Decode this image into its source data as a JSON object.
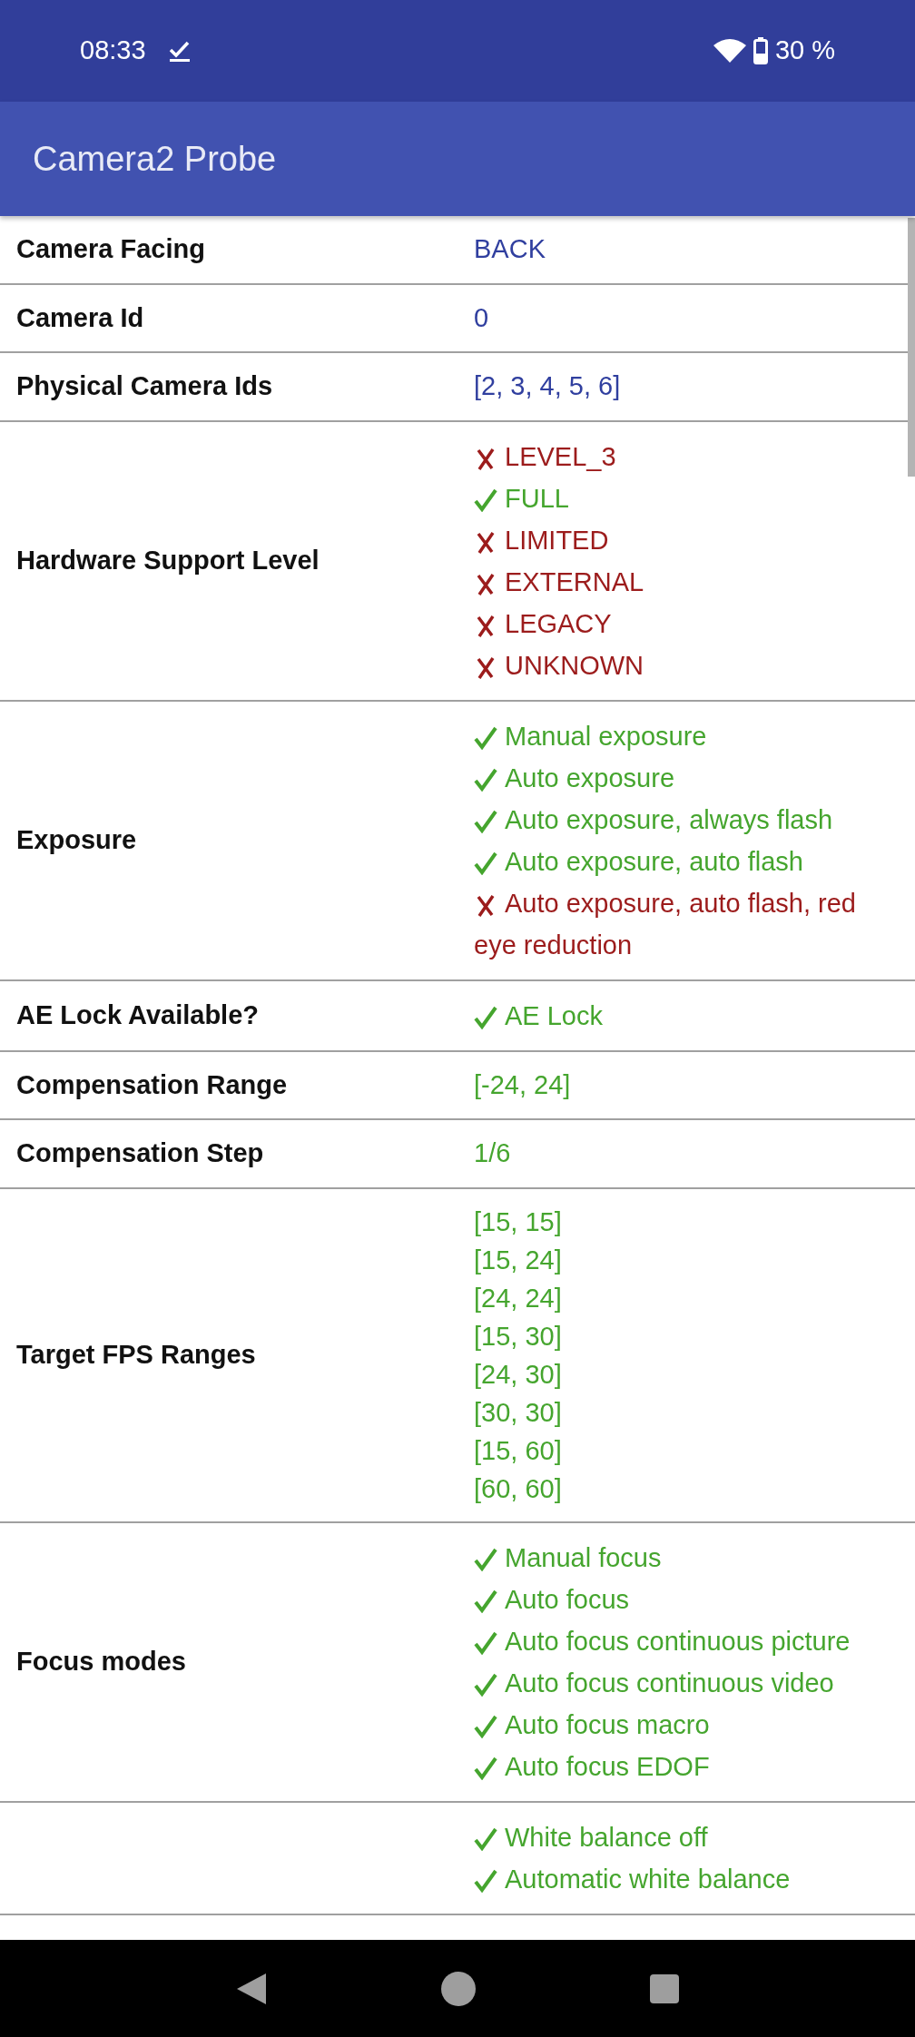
{
  "status_bar": {
    "time": "08:33",
    "battery": "30 %"
  },
  "app_bar": {
    "title": "Camera2 Probe"
  },
  "rows": [
    {
      "label": "Camera Facing",
      "kind": "info",
      "lines": [
        "BACK"
      ]
    },
    {
      "label": "Camera Id",
      "kind": "info",
      "lines": [
        "0"
      ]
    },
    {
      "label": "Physical Camera Ids",
      "kind": "info",
      "lines": [
        "[2, 3, 4, 5, 6]"
      ]
    },
    {
      "label": "Hardware Support Level",
      "kind": "checks",
      "items": [
        {
          "text": "LEVEL_3",
          "supported": false
        },
        {
          "text": "FULL",
          "supported": true
        },
        {
          "text": "LIMITED",
          "supported": false
        },
        {
          "text": "EXTERNAL",
          "supported": false
        },
        {
          "text": "LEGACY",
          "supported": false
        },
        {
          "text": "UNKNOWN",
          "supported": false
        }
      ]
    },
    {
      "label": "Exposure",
      "kind": "checks",
      "items": [
        {
          "text": "Manual exposure",
          "supported": true
        },
        {
          "text": "Auto exposure",
          "supported": true
        },
        {
          "text": "Auto exposure, always flash",
          "supported": true
        },
        {
          "text": "Auto exposure, auto flash",
          "supported": true
        },
        {
          "text": "Auto exposure, auto flash, red eye reduction",
          "supported": false
        }
      ]
    },
    {
      "label": "AE Lock Available?",
      "kind": "checks",
      "items": [
        {
          "text": "AE Lock",
          "supported": true
        }
      ]
    },
    {
      "label": "Compensation Range",
      "kind": "value",
      "lines": [
        "[-24, 24]"
      ]
    },
    {
      "label": "Compensation Step",
      "kind": "value",
      "lines": [
        "1/6"
      ]
    },
    {
      "label": "Target FPS Ranges",
      "kind": "value",
      "lines": [
        "[15, 15]",
        "[15, 24]",
        "[24, 24]",
        "[15, 30]",
        "[24, 30]",
        "[30, 30]",
        "[15, 60]",
        "[60, 60]"
      ]
    },
    {
      "label": "Focus modes",
      "kind": "checks",
      "items": [
        {
          "text": "Manual focus",
          "supported": true
        },
        {
          "text": "Auto focus",
          "supported": true
        },
        {
          "text": "Auto focus continuous picture",
          "supported": true
        },
        {
          "text": "Auto focus continuous video",
          "supported": true
        },
        {
          "text": "Auto focus macro",
          "supported": true
        },
        {
          "text": "Auto focus EDOF",
          "supported": true
        }
      ]
    },
    {
      "kind": "checks",
      "items": [
        {
          "text": "White balance off",
          "supported": true
        },
        {
          "text": "Automatic white balance",
          "supported": true
        }
      ]
    }
  ]
}
